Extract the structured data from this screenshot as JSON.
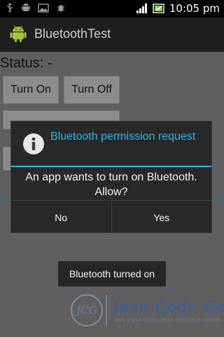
{
  "status_bar": {
    "time": "10:05 pm"
  },
  "app": {
    "title": "BluetoothTest"
  },
  "content": {
    "status_label": "Status: -",
    "buttons": {
      "turn_on": "Turn On",
      "turn_off": "Turn Off"
    }
  },
  "dialog": {
    "title": "Bluetooth permission request",
    "message": "An app wants to turn on Bluetooth. Allow?",
    "no_label": "No",
    "yes_label": "Yes"
  },
  "toast": {
    "text": "Bluetooth turned on"
  },
  "watermark": {
    "brand": "Java Code Geeks",
    "tagline": "JAVA 2 JAVA DEVELOPERS RESOURCE CENTER",
    "monogram": "JCG"
  },
  "colors": {
    "accent": "#33b5e5",
    "dialog_bg": "#282828",
    "dim_bg": "#5f5f5f",
    "watermark": "#2d5fb0"
  },
  "icons": [
    "usb-icon",
    "android-debug-icon",
    "image-icon",
    "bug-icon",
    "signal-icon",
    "battery-icon",
    "android-app-icon",
    "info-icon"
  ]
}
